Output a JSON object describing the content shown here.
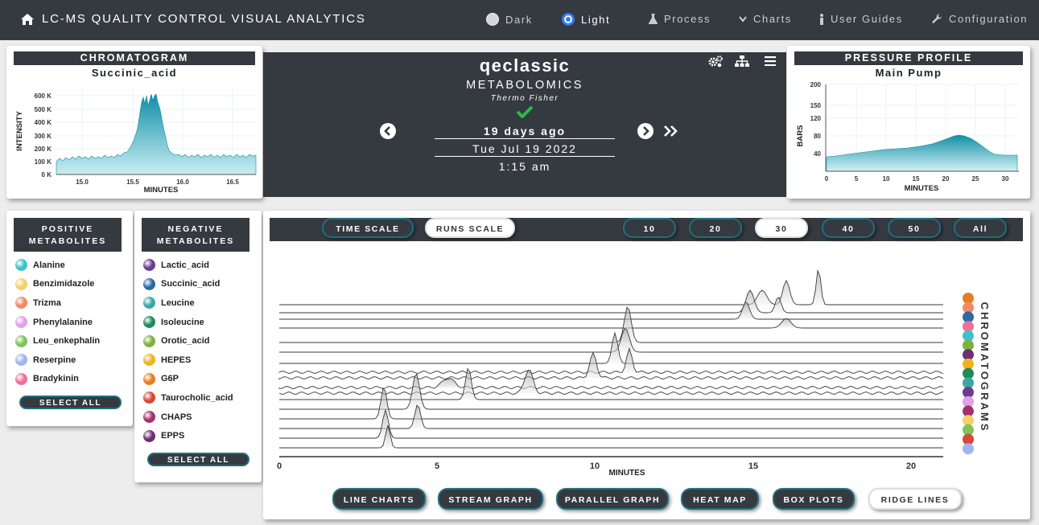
{
  "nav": {
    "title": "LC-MS QUALITY CONTROL VISUAL ANALYTICS",
    "theme_dark": "Dark",
    "theme_light": "Light",
    "process": "Process",
    "charts": "Charts",
    "user_guides": "User Guides",
    "configuration": "Configuration"
  },
  "chromatogram": {
    "header": "CHROMATOGRAM",
    "compound": "Succinic_acid",
    "ylabel": "INTENSITY",
    "xlabel": "MINUTES",
    "yticks": [
      "600 K",
      "500 K",
      "400 K",
      "300 K",
      "200 K",
      "100 K",
      "0 K"
    ],
    "xticks": [
      "15.0",
      "15.5",
      "16.0",
      "16.5"
    ]
  },
  "instrument": {
    "name": "qeclassic",
    "type": "METABOLOMICS",
    "vendor": "Thermo Fisher",
    "relative": "19 days ago",
    "date": "Tue Jul 19 2022",
    "time": "1:15 am"
  },
  "pressure": {
    "header": "PRESSURE PROFILE",
    "pump": "Main Pump",
    "ylabel": "BARS",
    "xlabel": "MINUTES",
    "yticks": [
      "200",
      "150",
      "120",
      "80",
      "40"
    ],
    "xticks": [
      "0",
      "5",
      "10",
      "15",
      "20",
      "25",
      "30"
    ]
  },
  "positive": {
    "header_line1": "POSITIVE",
    "header_line2": "METABOLITES",
    "select_all": "SELECT ALL",
    "items": [
      {
        "label": "Alanine",
        "color": "#3fc1c9"
      },
      {
        "label": "Benzimidazole",
        "color": "#f6cf6b"
      },
      {
        "label": "Trizma",
        "color": "#f08a64"
      },
      {
        "label": "Phenylalanine",
        "color": "#e2a0e8"
      },
      {
        "label": "Leu_enkephalin",
        "color": "#7ec45a"
      },
      {
        "label": "Reserpine",
        "color": "#9fb4f2"
      },
      {
        "label": "Bradykinin",
        "color": "#ef6f9a"
      }
    ]
  },
  "negative": {
    "header_line1": "NEGATIVE",
    "header_line2": "METABOLITES",
    "select_all": "SELECT ALL",
    "items": [
      {
        "label": "Lactic_acid",
        "color": "#6a3d8f"
      },
      {
        "label": "Succinic_acid",
        "color": "#2b6aa3"
      },
      {
        "label": "Leucine",
        "color": "#3aa7a3"
      },
      {
        "label": "Isoleucine",
        "color": "#1f8a5a"
      },
      {
        "label": "Orotic_acid",
        "color": "#7bb240"
      },
      {
        "label": "HEPES",
        "color": "#f1b21b"
      },
      {
        "label": "G6P",
        "color": "#e67e22"
      },
      {
        "label": "Taurocholic_acid",
        "color": "#d9473a"
      },
      {
        "label": "CHAPS",
        "color": "#a3306e"
      },
      {
        "label": "EPPS",
        "color": "#6b2f73"
      }
    ]
  },
  "ridge": {
    "time_scale": "TIME SCALE",
    "runs_scale": "RUNS SCALE",
    "counts": [
      "10",
      "20",
      "30",
      "40",
      "50",
      "All"
    ],
    "xticks": [
      "0",
      "5",
      "10",
      "15",
      "20"
    ],
    "xlabel": "MINUTES",
    "side_label": "CHROMATOGRAMS",
    "legend_colors": [
      "#e67e22",
      "#f08a64",
      "#2b6aa3",
      "#ef6f9a",
      "#3fc1c9",
      "#7bb240",
      "#6b2f73",
      "#f1b21b",
      "#1f8a5a",
      "#3aa7a3",
      "#6a3d8f",
      "#e2a0e8",
      "#a3306e",
      "#f6cf6b",
      "#7ec45a",
      "#d9473a",
      "#9fb4f2"
    ]
  },
  "chart_tabs": [
    "LINE CHARTS",
    "STREAM GRAPH",
    "PARALLEL GRAPH",
    "HEAT MAP",
    "BOX PLOTS",
    "RIDGE LINES"
  ]
}
